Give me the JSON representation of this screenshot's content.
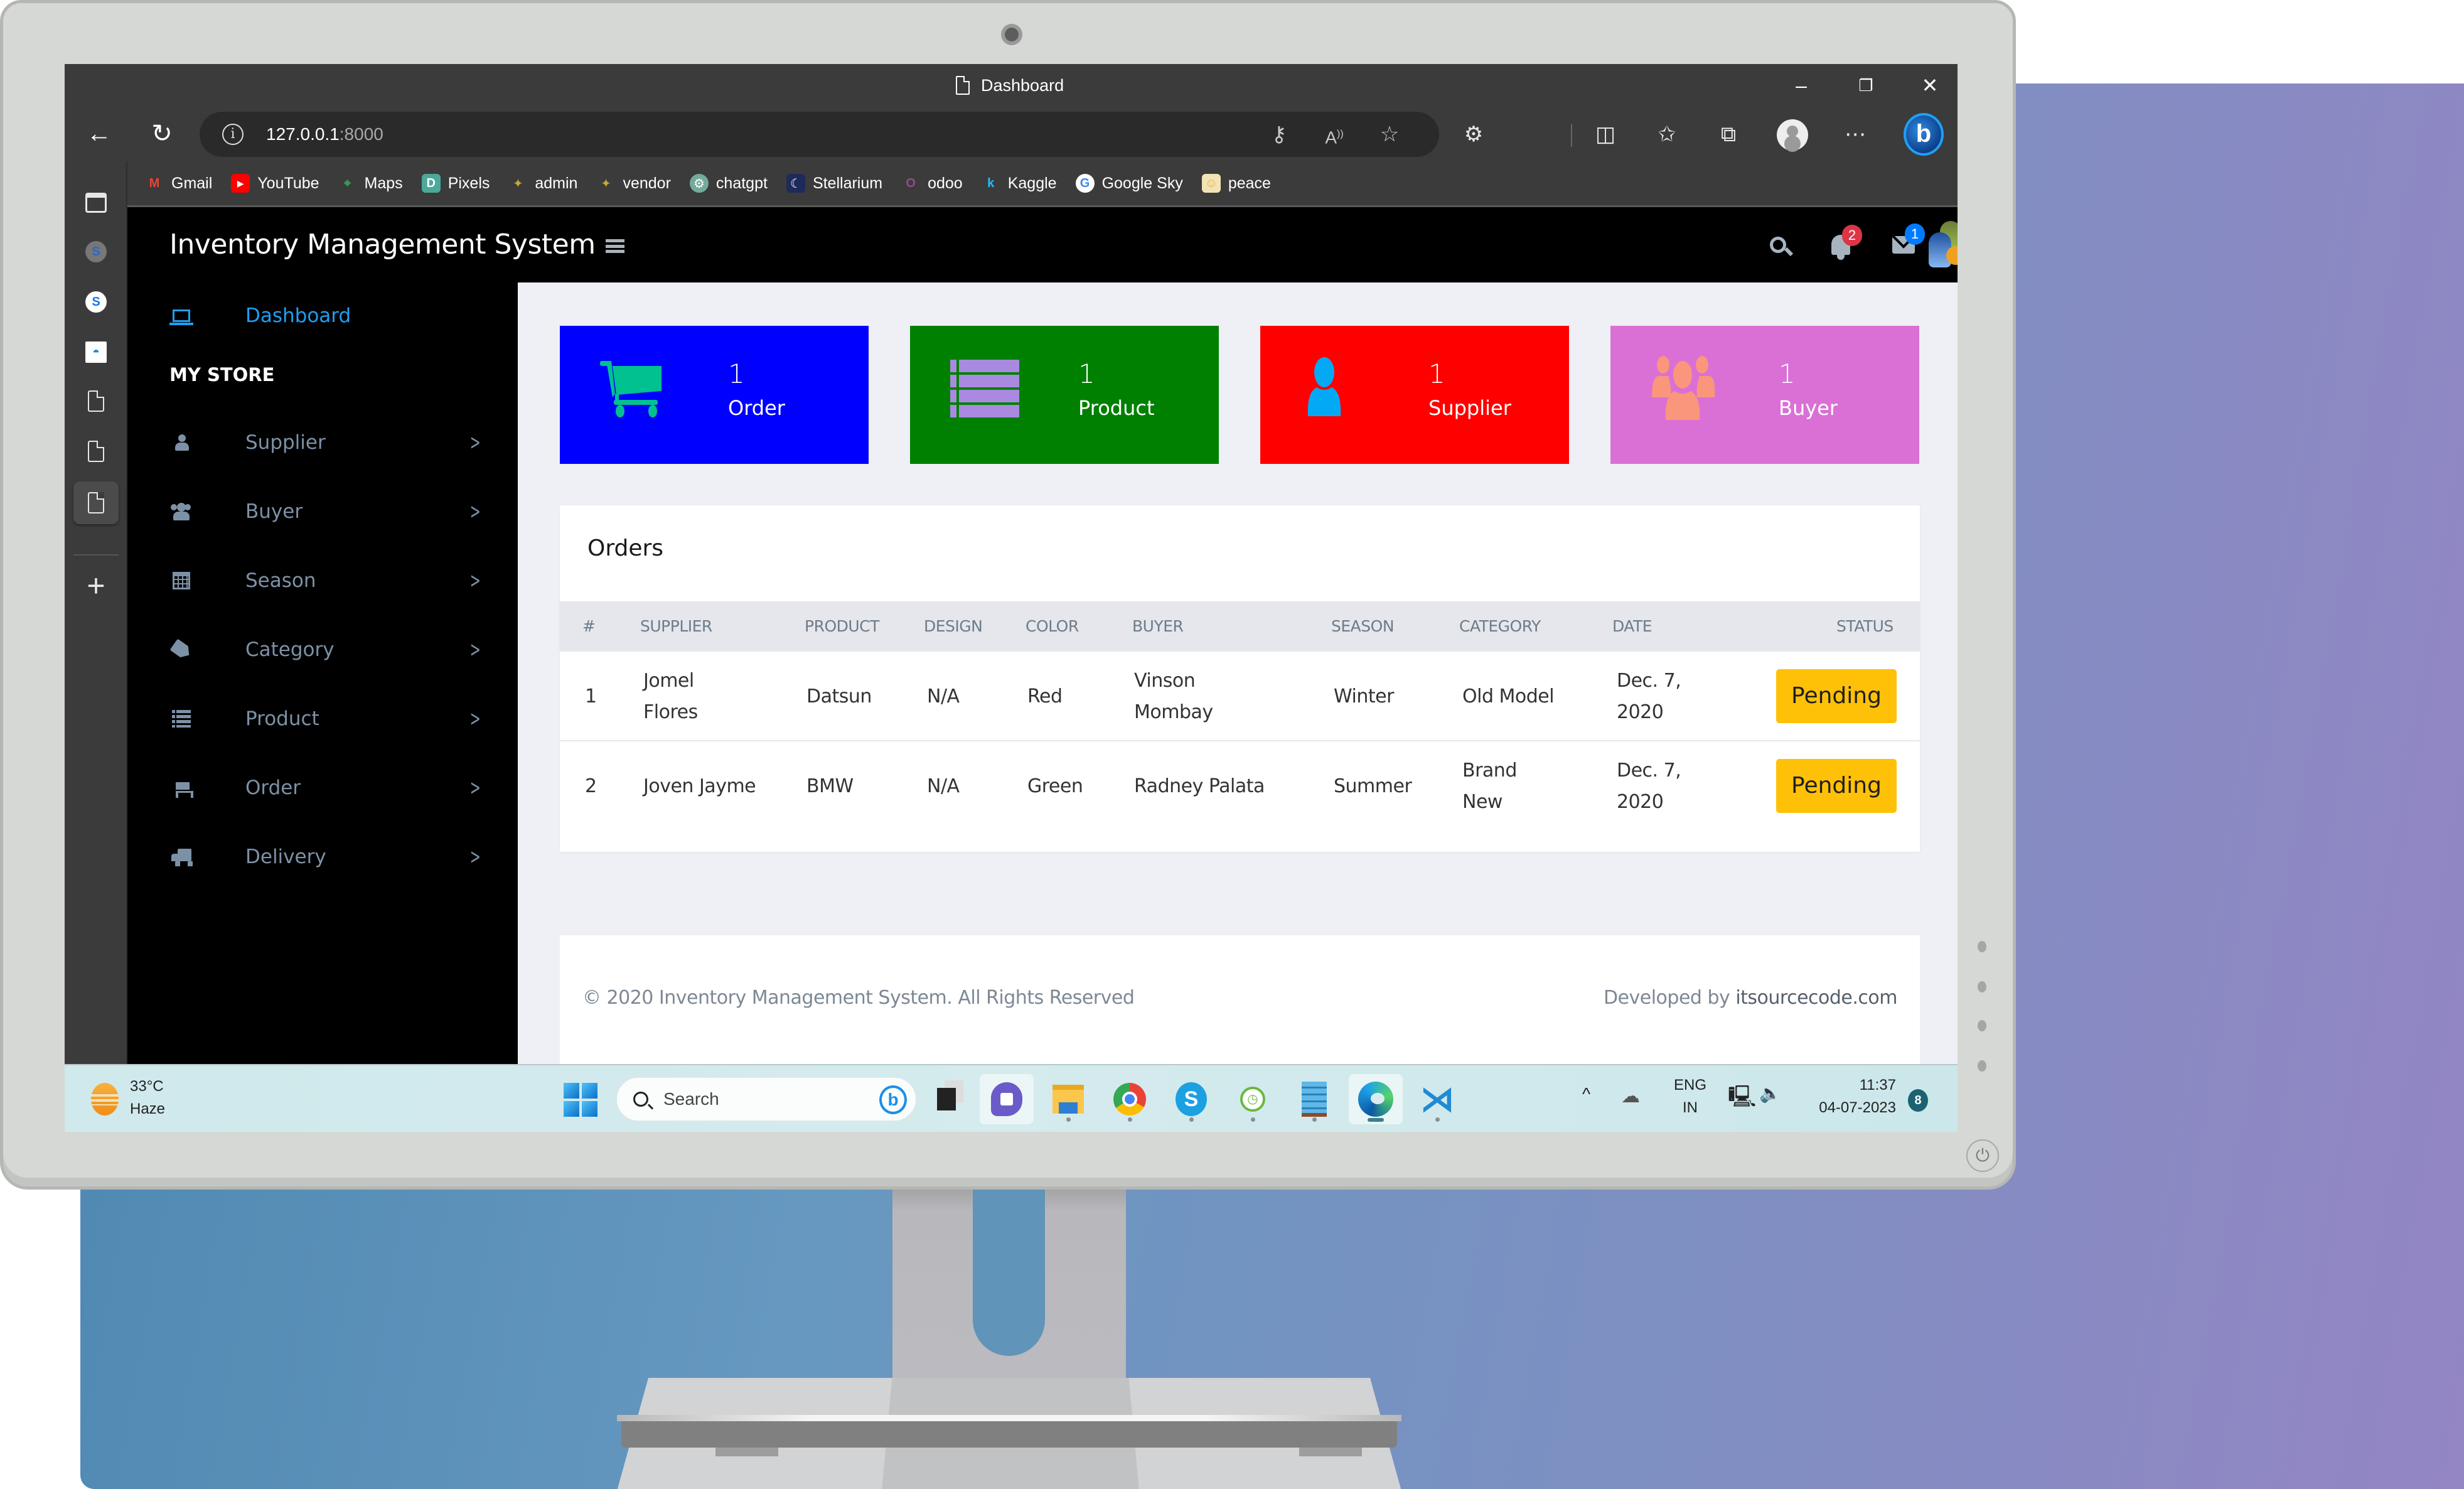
{
  "browser": {
    "tab_title": "Dashboard",
    "url_host": "127.0.0.1",
    "url_port": ":8000",
    "window_controls": {
      "minimize": "–",
      "restore": "❐",
      "close": "✕"
    },
    "bookmarks": [
      {
        "label": "Gmail",
        "icon": "gmail-icon",
        "glyph": "M",
        "color": "#ea4335"
      },
      {
        "label": "YouTube",
        "icon": "youtube-icon",
        "glyph": "▶",
        "color": "#ff0000"
      },
      {
        "label": "Maps",
        "icon": "maps-icon",
        "glyph": "⌖",
        "color": "#34a853"
      },
      {
        "label": "Pixels",
        "icon": "pixels-icon",
        "glyph": "D",
        "color": "#4aa99b"
      },
      {
        "label": "admin",
        "icon": "admin-icon",
        "glyph": "✦",
        "color": "#c7a93a"
      },
      {
        "label": "vendor",
        "icon": "vendor-icon",
        "glyph": "✦",
        "color": "#c7a93a"
      },
      {
        "label": "chatgpt",
        "icon": "chatgpt-icon",
        "glyph": "⚙",
        "color": "#74aa9c"
      },
      {
        "label": "Stellarium",
        "icon": "stellarium-icon",
        "glyph": "☾",
        "color": "#1e2a5a"
      },
      {
        "label": "odoo",
        "icon": "odoo-icon",
        "glyph": "O",
        "color": "#8f4c87"
      },
      {
        "label": "Kaggle",
        "icon": "kaggle-icon",
        "glyph": "k",
        "color": "#20beff"
      },
      {
        "label": "Google Sky",
        "icon": "google-icon",
        "glyph": "G",
        "color": "#ffffff"
      },
      {
        "label": "peace",
        "icon": "peace-icon",
        "glyph": "☺",
        "color": "#f3e3b4"
      }
    ]
  },
  "app": {
    "title": "Inventory Management System",
    "notifications_count": "2",
    "messages_count": "1",
    "colors": {
      "notif_badge": "#dc3545",
      "msg_badge": "#007bff",
      "accent": "#1e9ff2"
    }
  },
  "sidebar": {
    "dashboard": "Dashboard",
    "section_heading": "MY STORE",
    "items": [
      {
        "label": "Supplier",
        "icon": "user-icon"
      },
      {
        "label": "Buyer",
        "icon": "users-icon"
      },
      {
        "label": "Season",
        "icon": "calendar-icon"
      },
      {
        "label": "Category",
        "icon": "tag-icon"
      },
      {
        "label": "Product",
        "icon": "list-icon"
      },
      {
        "label": "Order",
        "icon": "cart-icon"
      },
      {
        "label": "Delivery",
        "icon": "truck-icon"
      }
    ]
  },
  "stats": [
    {
      "value": "1",
      "label": "Order",
      "bg": "#0000ff",
      "icon_color": "#00c18f"
    },
    {
      "value": "1",
      "label": "Product",
      "bg": "#008000",
      "icon_color": "#a98ae0"
    },
    {
      "value": "1",
      "label": "Supplier",
      "bg": "#ff0000",
      "icon_color": "#03a9f4"
    },
    {
      "value": "1",
      "label": "Buyer",
      "bg": "#da70d6",
      "icon_color": "#fa967b"
    }
  ],
  "orders": {
    "title": "Orders",
    "columns": [
      "#",
      "Supplier",
      "Product",
      "Design",
      "Color",
      "Buyer",
      "Season",
      "Category",
      "Date",
      "Status"
    ],
    "rows": [
      {
        "num": "1",
        "supplier": "Jomel Flores",
        "product": "Datsun",
        "design": "N/A",
        "color": "Red",
        "buyer": "Vinson Mombay",
        "season": "Winter",
        "category": "Old Model",
        "date": "Dec. 7, 2020",
        "status": "Pending"
      },
      {
        "num": "2",
        "supplier": "Joven Jayme",
        "product": "BMW",
        "design": "N/A",
        "color": "Green",
        "buyer": "Radney Palata",
        "season": "Summer",
        "category": "Brand New",
        "date": "Dec. 7, 2020",
        "status": "Pending"
      }
    ],
    "status_color": "#ffc107"
  },
  "footer": {
    "copyright": "© 2020 Inventory Management System. All Rights Reserved",
    "developed_prefix": "Developed by ",
    "developed_by": "itsourcecode.com"
  },
  "taskbar": {
    "weather_temp": "33°C",
    "weather_desc": "Haze",
    "search_placeholder": "Search",
    "language_line1": "ENG",
    "language_line2": "IN",
    "time": "11:37",
    "date": "04-07-2023",
    "notification_count": "8"
  }
}
